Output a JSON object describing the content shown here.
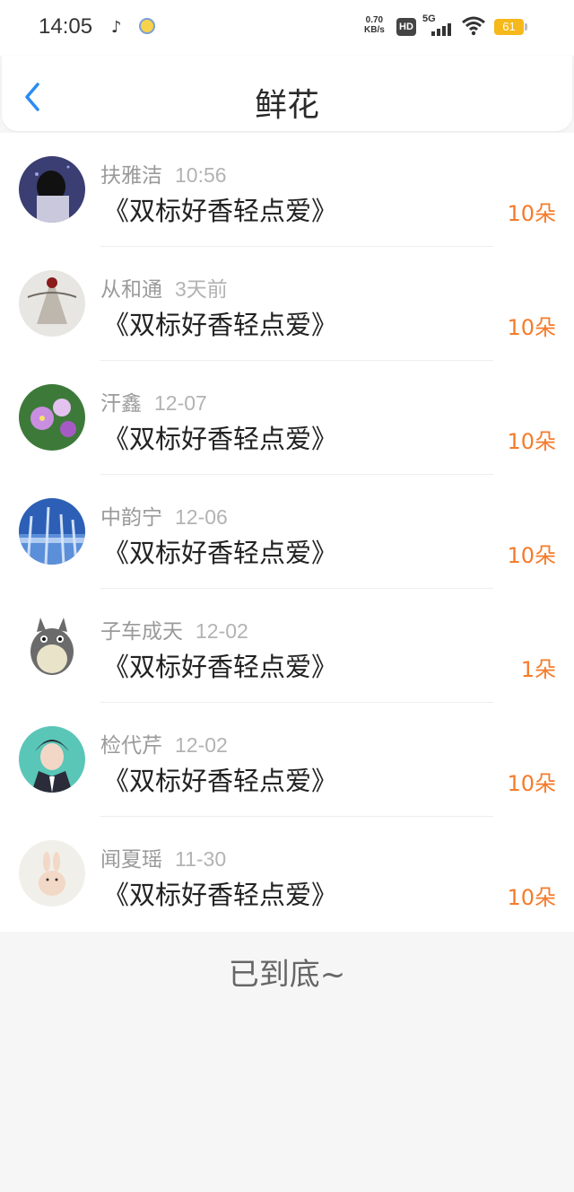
{
  "status_bar": {
    "time": "14:05",
    "speed_value": "0.70",
    "speed_unit": "KB/s",
    "hd": "HD",
    "network": "5G",
    "battery": "61"
  },
  "header": {
    "title": "鲜花",
    "back_icon": "chevron-left-icon"
  },
  "items": [
    {
      "name": "扶雅洁",
      "time": "10:56",
      "work": "《双标好香轻点爱》",
      "count": "10朵"
    },
    {
      "name": "从和通",
      "time": "3天前",
      "work": "《双标好香轻点爱》",
      "count": "10朵"
    },
    {
      "name": "汗鑫",
      "time": "12-07",
      "work": "《双标好香轻点爱》",
      "count": "10朵"
    },
    {
      "name": "中韵宁",
      "time": "12-06",
      "work": "《双标好香轻点爱》",
      "count": "10朵"
    },
    {
      "name": "子车成天",
      "time": "12-02",
      "work": "《双标好香轻点爱》",
      "count": "1朵"
    },
    {
      "name": "检代芹",
      "time": "12-02",
      "work": "《双标好香轻点爱》",
      "count": "10朵"
    },
    {
      "name": "闻夏瑶",
      "time": "11-30",
      "work": "《双标好香轻点爱》",
      "count": "10朵"
    }
  ],
  "footer": {
    "text": "已到底~"
  },
  "colors": {
    "accent": "#2b8cf2",
    "count": "#f57b2a",
    "background": "#f7f6f6"
  }
}
